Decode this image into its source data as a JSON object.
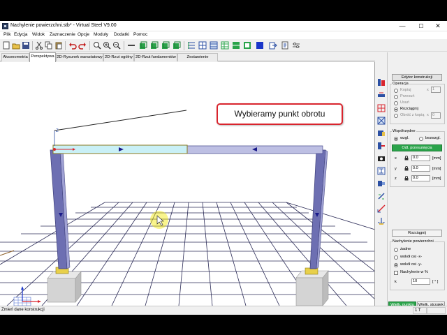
{
  "window": {
    "title": "Nachylenie powierzchni.stb* - Virtual Steel V9.00",
    "controls": {
      "minimize": "—",
      "maximize": "☐",
      "close": "✕"
    }
  },
  "menu": [
    "Plik",
    "Edycja",
    "Widok",
    "Zaznaczenie",
    "Opcje",
    "Moduły",
    "Dodatki",
    "Pomoc"
  ],
  "tabs": [
    "Aksonometria",
    "Perspektywa",
    "2D-Rysunek warsztatowy",
    "2D-Rzut ogólny",
    "2D-Rzut fundamentów",
    "Zestawienie materiału"
  ],
  "active_tab": "Perspektywa",
  "callout": {
    "text": "Wybieramy punkt obrotu"
  },
  "viewport": {
    "axis_label": "Z",
    "colors": {
      "grid": "#2b2b57",
      "column": "#6d6fb2",
      "beam_selected": "#c9f0f6",
      "beam": "#bdbfe3",
      "footing": "#d0d0d0",
      "cursor_highlight": "#f2e600"
    }
  },
  "panel": {
    "header_button": "Edytor konstrukcji",
    "operation": {
      "label": "Operacja",
      "options": [
        "Kopiuj",
        "Przesuń",
        "Usuń",
        "Rozciągnij",
        "Obróć z kopią"
      ],
      "selected": "Rozciągnij",
      "copy_count_x": "x",
      "copy_count_value": "1",
      "rotate_copy_x": "x",
      "rotate_copy_value": "0"
    },
    "coords": {
      "label": "Współrzędne",
      "options": [
        "wzgl.",
        "bezwzgl."
      ],
      "selected": "wzgl.",
      "button": "Odl. przesunięcia",
      "rows": [
        {
          "axis": "x",
          "value": "0.0",
          "unit": "[mm]"
        },
        {
          "axis": "y",
          "value": "0.0",
          "unit": "[mm]"
        },
        {
          "axis": "z",
          "value": "0.0",
          "unit": "[mm]"
        }
      ]
    },
    "stretch_button": "Rozciągnij",
    "slope": {
      "label": "Nachylenie powierzchni",
      "options": [
        "żadne",
        "wokół osi -x-",
        "wokół osi -y-"
      ],
      "selected": "wokół osi -y-",
      "percent_label": "Nachylenie w %",
      "k_label": "k",
      "k_value": "10",
      "k_unit": "[ ° ]"
    },
    "pick_button": "Wielk. punktu",
    "arrow_button": "Wielk. strzałek"
  },
  "status": {
    "text": "Zmień dane konstrukcji",
    "cell": "1 T"
  }
}
